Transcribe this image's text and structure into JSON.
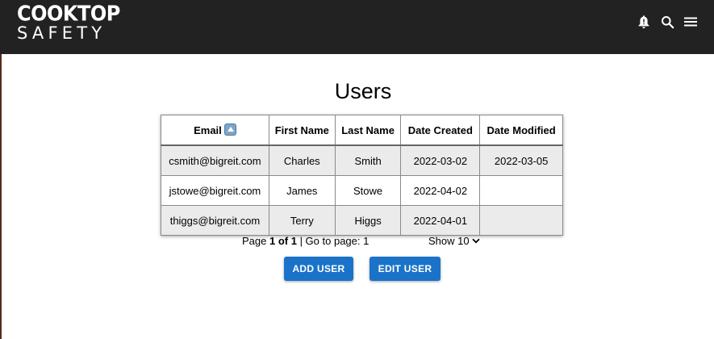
{
  "brand": {
    "line1": "COOKTOP",
    "line2": "SAFETY"
  },
  "appbar": {
    "icons": [
      "notification-bell-icon",
      "search-icon",
      "menu-icon"
    ],
    "background": "#222222"
  },
  "page": {
    "title": "Users"
  },
  "table": {
    "columns": [
      "Email",
      "First Name",
      "Last Name",
      "Date Created",
      "Date Modified"
    ],
    "sort": {
      "column": "Email",
      "direction": "ascending",
      "icon": "sort-ascending-icon"
    },
    "rows": [
      {
        "email": "csmith@bigreit.com",
        "first_name": "Charles",
        "last_name": "Smith",
        "date_created": "2022-03-02",
        "date_modified": "2022-03-05"
      },
      {
        "email": "jstowe@bigreit.com",
        "first_name": "James",
        "last_name": "Stowe",
        "date_created": "2022-04-02",
        "date_modified": ""
      },
      {
        "email": "thiggs@bigreit.com",
        "first_name": "Terry",
        "last_name": "Higgs",
        "date_created": "2022-04-01",
        "date_modified": ""
      }
    ]
  },
  "pagination": {
    "page_prefix": "Page ",
    "page_current": "1 of 1",
    "goto_text": " | Go to page: ",
    "goto_value": "1",
    "show_label": "Show 10"
  },
  "actions": {
    "add_user": "ADD USER",
    "edit_user": "EDIT USER",
    "button_color": "#1a73c9"
  }
}
